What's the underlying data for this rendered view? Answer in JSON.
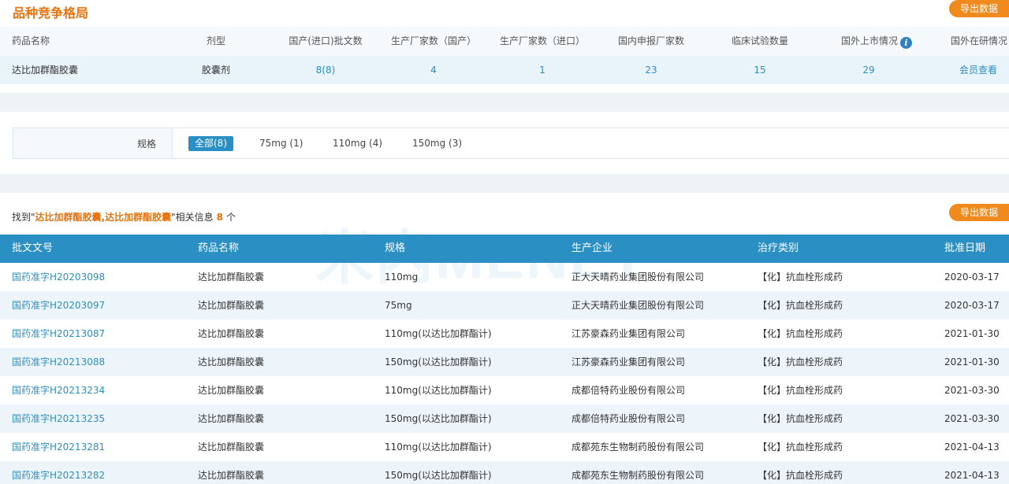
{
  "section": {
    "title": "品种竞争格局",
    "export_label": "导出数据"
  },
  "summary": {
    "headers": [
      "药品名称",
      "剂型",
      "国产(进口)批文数",
      "生产厂家数（国产）",
      "生产厂家数（进口）",
      "国内申报厂家数",
      "临床试验数量",
      "国外上市情况",
      "国外在研情况"
    ],
    "row": {
      "drug_name": "达比加群酯胶囊",
      "dosage_form": "胶囊剂",
      "approvals": "8(8)",
      "domestic_mfr": "4",
      "import_mfr": "1",
      "domestic_applicants": "23",
      "clinical_trials": "15",
      "overseas_marketed": "29",
      "overseas_research": "会员查看"
    }
  },
  "spec_filter": {
    "label": "规格",
    "options": [
      "全部(8)",
      "75mg (1)",
      "110mg (4)",
      "150mg (3)"
    ],
    "selected": "全部(8)"
  },
  "results": {
    "prefix": "找到\"",
    "keyword": "达比加群酯胶囊,达比加群酯胶囊",
    "middle": "\"相关信息",
    "count": "8",
    "suffix": "个",
    "export_label": "导出数据"
  },
  "watermark": "米内MENET",
  "table": {
    "headers": [
      "批文文号",
      "药品名称",
      "规格",
      "生产企业",
      "治疗类别",
      "批准日期"
    ],
    "rows": [
      [
        "国药准字H20203098",
        "达比加群酯胶囊",
        "110mg",
        "正大天晴药业集团股份有限公司",
        "【化】抗血栓形成药",
        "2020-03-17"
      ],
      [
        "国药准字H20203097",
        "达比加群酯胶囊",
        "75mg",
        "正大天晴药业集团股份有限公司",
        "【化】抗血栓形成药",
        "2020-03-17"
      ],
      [
        "国药准字H20213087",
        "达比加群酯胶囊",
        "110mg(以达比加群酯计)",
        "江苏豪森药业集团有限公司",
        "【化】抗血栓形成药",
        "2021-01-30"
      ],
      [
        "国药准字H20213088",
        "达比加群酯胶囊",
        "150mg(以达比加群酯计)",
        "江苏豪森药业集团有限公司",
        "【化】抗血栓形成药",
        "2021-01-30"
      ],
      [
        "国药准字H20213234",
        "达比加群酯胶囊",
        "110mg(以达比加群酯计)",
        "成都倍特药业股份有限公司",
        "【化】抗血栓形成药",
        "2021-03-30"
      ],
      [
        "国药准字H20213235",
        "达比加群酯胶囊",
        "150mg(以达比加群酯计)",
        "成都倍特药业股份有限公司",
        "【化】抗血栓形成药",
        "2021-03-30"
      ],
      [
        "国药准字H20213281",
        "达比加群酯胶囊",
        "110mg(以达比加群酯计)",
        "成都苑东生物制药股份有限公司",
        "【化】抗血栓形成药",
        "2021-04-13"
      ],
      [
        "国药准字H20213282",
        "达比加群酯胶囊",
        "150mg(以达比加群酯计)",
        "成都苑东生物制药股份有限公司",
        "【化】抗血栓形成药",
        "2021-04-13"
      ]
    ]
  },
  "colors": {
    "accent_orange": "#f08a1c",
    "header_blue": "#2a8fc2",
    "link_blue": "#2d8fc0"
  }
}
